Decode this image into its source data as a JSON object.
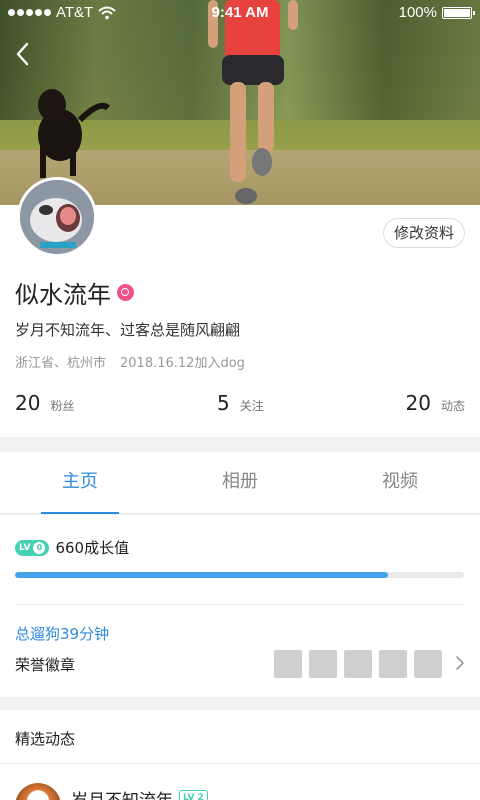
{
  "status_bar": {
    "carrier": "AT&T",
    "time": "9:41 AM",
    "battery": "100%"
  },
  "profile": {
    "edit_label": "修改资料",
    "name": "似水流年",
    "bio": "岁月不知流年、过客总是随风翩翩",
    "location": "浙江省、杭州市",
    "joined": "2018.16.12加入dog",
    "stats": [
      {
        "value": "20",
        "label": "粉丝"
      },
      {
        "value": "5",
        "label": "关注"
      },
      {
        "value": "20",
        "label": "动态"
      }
    ]
  },
  "tabs": [
    {
      "label": "主页",
      "active": true
    },
    {
      "label": "相册",
      "active": false
    },
    {
      "label": "视频",
      "active": false
    }
  ],
  "growth": {
    "level_prefix": "LV",
    "level": "0",
    "value_text": "660成长值",
    "progress": 0.83,
    "walk_time": "总遛狗39分钟",
    "honor_label": "荣誉徽章"
  },
  "featured": {
    "title": "精选动态",
    "post": {
      "name": "岁月不知流年",
      "level_prefix": "LV",
      "level": "2"
    }
  },
  "colors": {
    "accent": "#2f8ce0",
    "level": "#46d1b4",
    "progress": "#45a3ec",
    "badge": "#f0508a"
  },
  "icons": [
    "back-chevron-icon",
    "wifi-icon",
    "battery-icon",
    "verified-badge-icon",
    "chevron-right-icon"
  ]
}
